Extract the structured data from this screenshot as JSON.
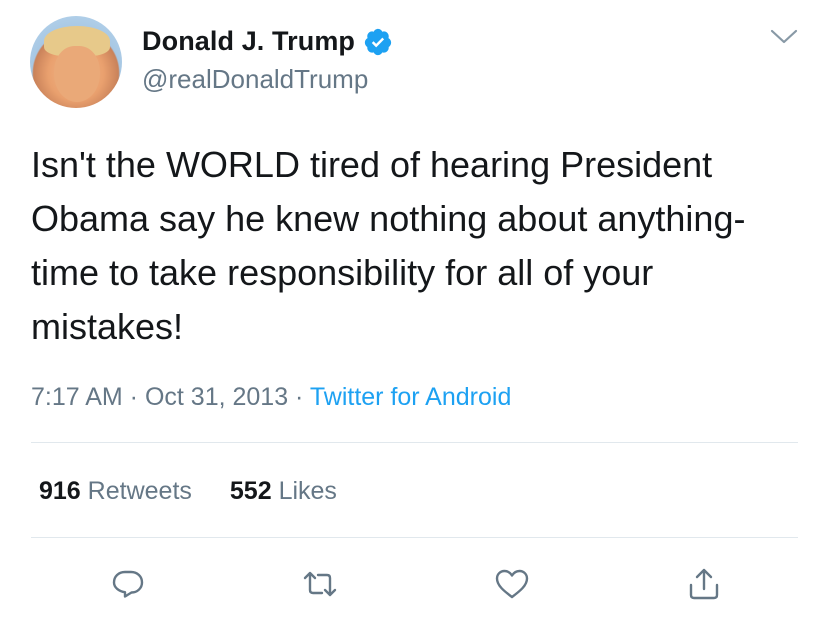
{
  "author": {
    "display_name": "Donald J. Trump",
    "handle": "@realDonaldTrump",
    "verified": true
  },
  "tweet": {
    "text": "Isn't the WORLD tired of hearing President Obama say he knew nothing about anything-time to take responsibility for all of your mistakes!"
  },
  "meta": {
    "time": "7:17 AM",
    "separator1": " · ",
    "date": "Oct 31, 2013",
    "separator2": " · ",
    "source": "Twitter for Android"
  },
  "stats": {
    "retweets_count": "916",
    "retweets_label": "Retweets",
    "likes_count": "552",
    "likes_label": "Likes"
  },
  "actions": {
    "reply_icon": "reply-icon",
    "retweet_icon": "retweet-icon",
    "like_icon": "heart-icon",
    "share_icon": "share-icon"
  },
  "colors": {
    "accent": "#1da1f2",
    "secondary_text": "#657786",
    "primary_text": "#14171a",
    "divider": "#e1e8ed"
  }
}
